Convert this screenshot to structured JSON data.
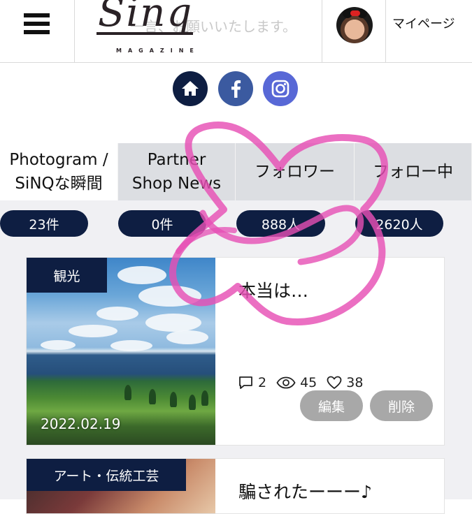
{
  "header": {
    "logo_text": "Sinq",
    "logo_sub": "MAGAZINE",
    "marquee_text": "一言、お願いいたします。",
    "mypage_label": "マイページ",
    "menu_icon": "hamburger-menu-icon",
    "avatar_icon": "user-avatar"
  },
  "social": [
    {
      "name": "home",
      "icon": "home-icon"
    },
    {
      "name": "facebook",
      "icon": "facebook-icon"
    },
    {
      "name": "instagram",
      "icon": "instagram-icon"
    }
  ],
  "tabs": [
    {
      "label": "Photogram /\nSiNQな瞬間",
      "count": "23件",
      "active": true
    },
    {
      "label": "Partner\nShop News",
      "count": "0件",
      "active": false
    },
    {
      "label": "フォロワー",
      "count": "888人",
      "active": false
    },
    {
      "label": "フォロー中",
      "count": "2620人",
      "active": false
    }
  ],
  "posts": [
    {
      "category": "観光",
      "title": "本当は…",
      "date": "2022.02.19",
      "comments": "2",
      "views": "45",
      "likes": "38",
      "edit_label": "編集",
      "delete_label": "削除"
    },
    {
      "category": "アート・伝統工芸",
      "title": "騙されたーーー♪"
    }
  ],
  "colors": {
    "navy": "#0e1e42",
    "facebook": "#3b5aa0",
    "instagram": "#5868d6",
    "button_gray": "#a8a8a8",
    "scribble_pink": "#e64fb4"
  }
}
